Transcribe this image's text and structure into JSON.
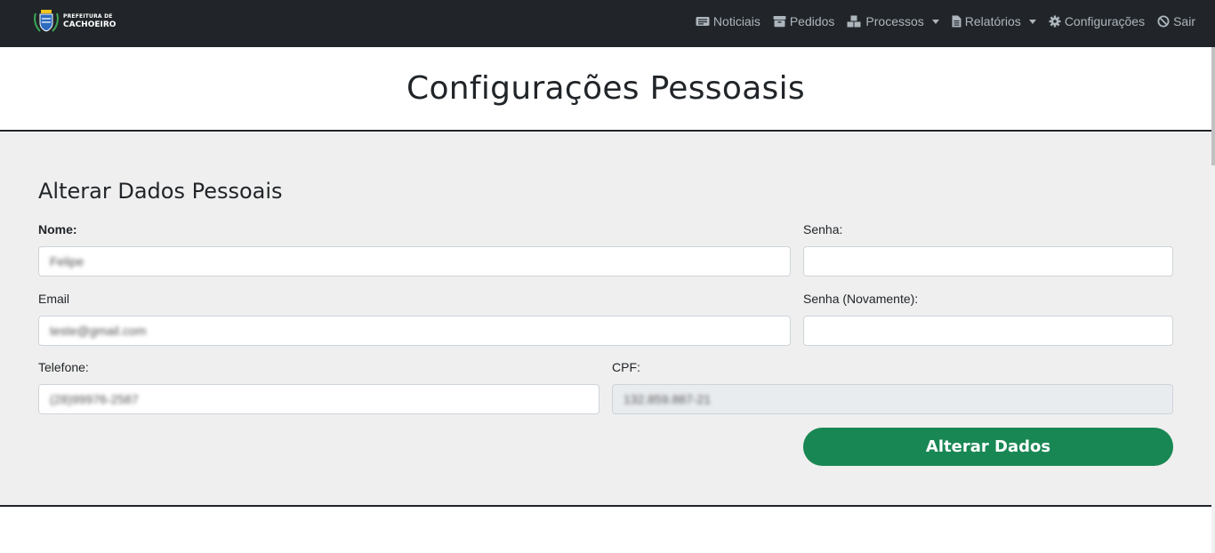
{
  "brand": {
    "line1": "PREFEITURA DE",
    "line2": "CACHOEIRO"
  },
  "nav": {
    "items": [
      {
        "label": "Noticiais",
        "icon": "newspaper-icon"
      },
      {
        "label": "Pedidos",
        "icon": "box-icon"
      },
      {
        "label": "Processos",
        "icon": "boxes-icon",
        "dropdown": true
      },
      {
        "label": "Relatórios",
        "icon": "file-icon",
        "dropdown": true
      },
      {
        "label": "Configurações",
        "icon": "gear-icon"
      },
      {
        "label": "Sair",
        "icon": "ban-icon"
      }
    ]
  },
  "page": {
    "title": "Configurações Pessoasis"
  },
  "form": {
    "title": "Alterar Dados Pessoais",
    "nome_label": "Nome:",
    "nome_value": "Felipe",
    "email_label": "Email",
    "email_value": "teste@gmail.com",
    "telefone_label": "Telefone:",
    "telefone_value": "(28)99976-2587",
    "senha_label": "Senha:",
    "senha_value": "",
    "senha2_label": "Senha (Novamente):",
    "senha2_value": "",
    "cpf_label": "CPF:",
    "cpf_value": "132.859.887-21",
    "submit_label": "Alterar Dados"
  },
  "colors": {
    "navbar_bg": "#212529",
    "nav_text": "#adb5bd",
    "panel_bg": "#efefef",
    "button_bg": "#198754"
  }
}
